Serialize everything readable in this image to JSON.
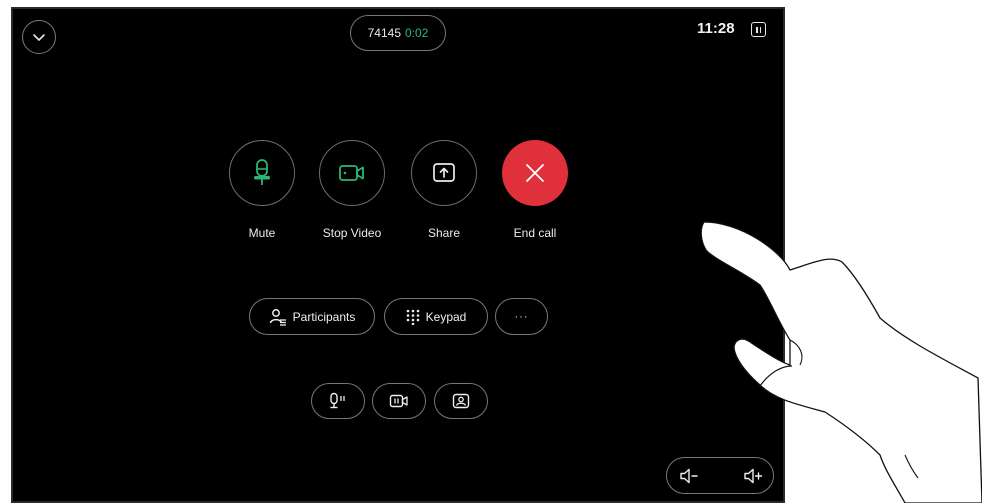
{
  "header": {
    "call_number": "74145",
    "call_duration": "0:02",
    "clock": "11:28",
    "collapse_icon": "chevron-down-icon",
    "side_panel_icon": "panel-icon"
  },
  "controls": {
    "mute": {
      "label": "Mute",
      "icon": "microphone-icon"
    },
    "stop_video": {
      "label": "Stop Video",
      "icon": "video-camera-icon"
    },
    "share": {
      "label": "Share",
      "icon": "share-screen-icon"
    },
    "end_call": {
      "label": "End call",
      "icon": "close-icon",
      "color": "#e0303c"
    }
  },
  "secondary": {
    "participants_label": "Participants",
    "keypad_label": "Keypad",
    "more_label": "···"
  },
  "small_controls": [
    "microphone-settings-icon",
    "camera-settings-icon",
    "self-view-icon"
  ],
  "volume": {
    "down_icon": "volume-down-icon",
    "up_icon": "volume-up-icon"
  },
  "colors": {
    "accent_green": "#2bb673",
    "end_red": "#e0303c",
    "background": "#000000"
  }
}
